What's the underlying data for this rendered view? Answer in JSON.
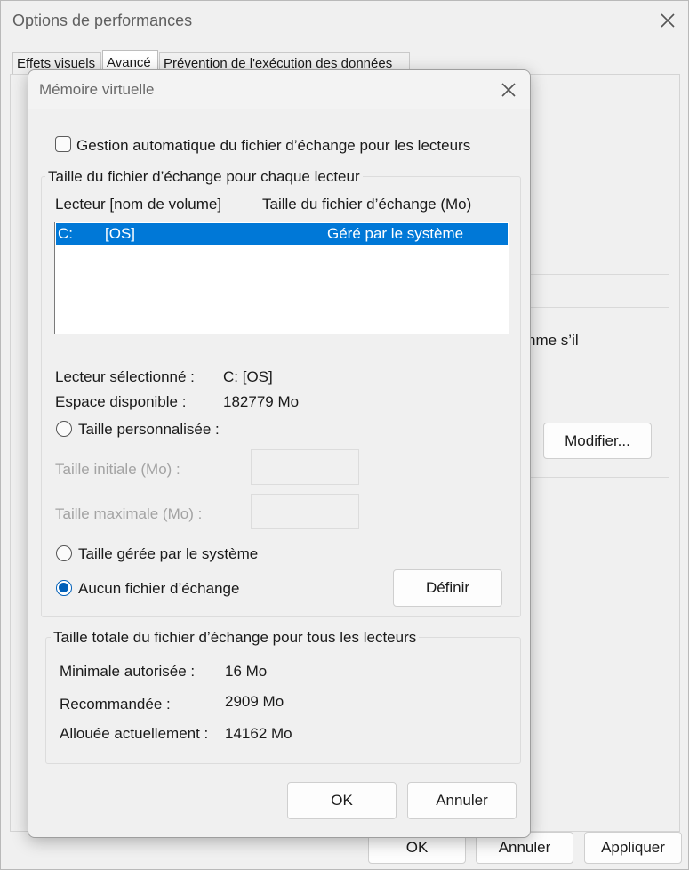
{
  "perf": {
    "title": "Options de performances",
    "tabs": [
      "Effets visuels",
      "Avancé",
      "Prévention de l'exécution des données"
    ],
    "partial_text": "nme s’il",
    "modify_label": "Modifier...",
    "ok_label": "OK",
    "cancel_label": "Annuler",
    "apply_label": "Appliquer"
  },
  "vm": {
    "title": "Mémoire virtuelle",
    "auto_manage_label": "Gestion automatique du fichier d’échange pour les lecteurs",
    "auto_manage_checked": false,
    "per_drive_legend": "Taille du fichier d’échange pour chaque lecteur",
    "columns": [
      "Lecteur [nom de volume]",
      "Taille du fichier d’échange (Mo)"
    ],
    "drives": [
      {
        "letter": "C:",
        "volume": "[OS]",
        "size": "Géré par le système",
        "selected": true
      }
    ],
    "selected_drive_label": "Lecteur sélectionné :",
    "selected_drive_value": "C:  [OS]",
    "free_space_label": "Espace disponible :",
    "free_space_value": "182779 Mo",
    "custom_size_label": "Taille personnalisée :",
    "initial_size_label": "Taille initiale (Mo) :",
    "max_size_label": "Taille maximale (Mo) :",
    "system_managed_label": "Taille gérée par le système",
    "no_paging_label": "Aucun fichier d’échange",
    "selected_option": "no_paging",
    "set_label": "Définir",
    "total_legend": "Taille totale du fichier d’échange pour tous les lecteurs",
    "min_label": "Minimale autorisée :",
    "min_value": "16 Mo",
    "recommended_label": "Recommandée :",
    "recommended_value": "2909 Mo",
    "current_label": "Allouée actuellement :",
    "current_value": "14162 Mo",
    "ok_label": "OK",
    "cancel_label": "Annuler"
  },
  "colors": {
    "selection": "#0078d7",
    "radio_accent": "#005fb8"
  }
}
